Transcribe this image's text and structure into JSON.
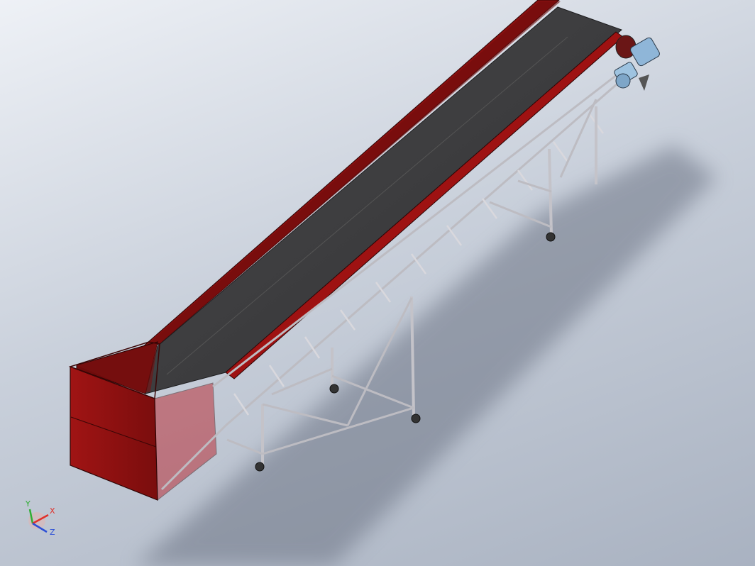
{
  "colors": {
    "background_top": "#eef1f6",
    "background_bottom": "#a9b2c1",
    "sidewall_red": "#8f1010",
    "sidewall_red_dark": "#5e0a0a",
    "belt_dark": "#3d3d3f",
    "frame_steel": "#c8c6cc",
    "motor_blue": "#8fb6d8",
    "shadow": "#6d7585"
  },
  "triad": {
    "x_label": "X",
    "y_label": "Y",
    "z_label": "Z",
    "x_color": "#e0302a",
    "y_color": "#2fae34",
    "z_color": "#2c4fd6"
  }
}
